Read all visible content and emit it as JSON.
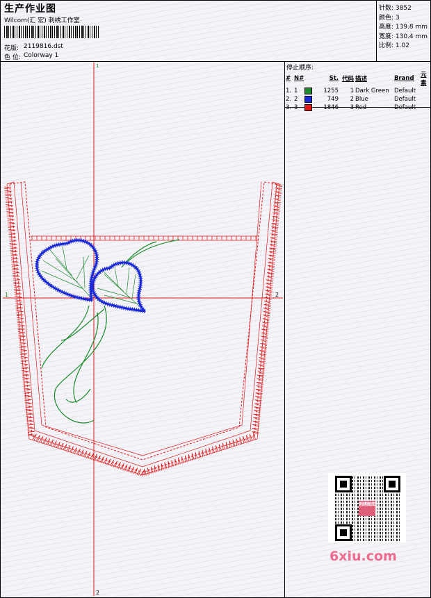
{
  "header": {
    "title": "生产作业图",
    "company": "Wilcom(汇 宏) 刺绣工作室",
    "design_label": "花版:",
    "design_file": "2119816.dst",
    "colorway_label": "色 位:",
    "colorway_name": "Colorway 1"
  },
  "stats": {
    "stitches": "针数: 3852",
    "colors": "颜色: 3",
    "height": "高度: 139.8 mm",
    "width": "宽度: 130.4 mm",
    "scale": "比例: 1.02"
  },
  "stop_sequence": {
    "title": "停止顺序:",
    "columns": [
      "#",
      "N#",
      "St.",
      "代码",
      "描述",
      "Brand",
      "元素"
    ],
    "rows": [
      {
        "idx": "1.",
        "needle": "1",
        "color": "#1a8a2a",
        "stitches": "1255",
        "code": "1",
        "desc": "Dark Green",
        "brand": "Default"
      },
      {
        "idx": "2.",
        "needle": "2",
        "color": "#1a2ad8",
        "stitches": "749",
        "code": "2",
        "desc": "Blue",
        "brand": "Default"
      },
      {
        "idx": "3.",
        "needle": "3",
        "color": "#e01818",
        "stitches": "1846",
        "code": "3",
        "desc": "Red",
        "brand": "Default"
      }
    ]
  },
  "crosshair": {
    "top": "1",
    "left": "1",
    "right": "2",
    "bottom": "2"
  },
  "qr": {
    "logo_text": "刺绣图库"
  },
  "watermark": "6xiu.com",
  "colors": {
    "dark_green": "#1a8a2a",
    "blue": "#1a2ad8",
    "red": "#e01818"
  }
}
